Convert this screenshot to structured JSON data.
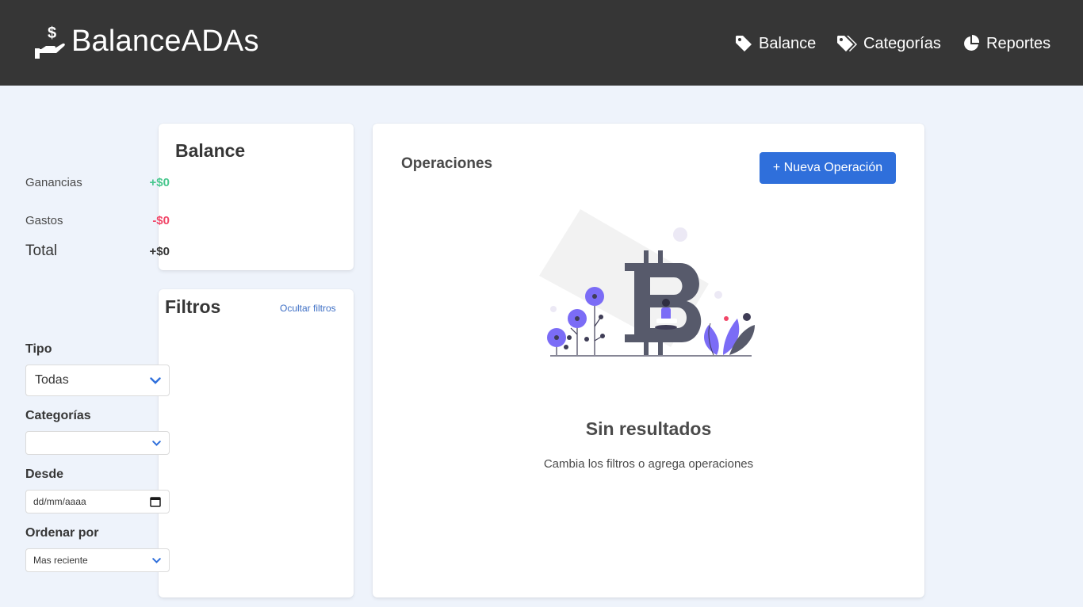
{
  "brand": {
    "name": "BalanceADAs",
    "icon": "hand-holding-dollar-icon"
  },
  "nav": {
    "balance": {
      "label": "Balance",
      "icon": "tag-icon"
    },
    "categorias": {
      "label": "Categorías",
      "icon": "tags-icon"
    },
    "reportes": {
      "label": "Reportes",
      "icon": "pie-chart-icon"
    }
  },
  "balance": {
    "title": "Balance",
    "ganancias": {
      "label": "Ganancias",
      "value": "+$0"
    },
    "gastos": {
      "label": "Gastos",
      "value": "-$0"
    },
    "total": {
      "label": "Total",
      "value": "+$0"
    }
  },
  "filtros": {
    "title": "Filtros",
    "toggle_label": "Ocultar filtros",
    "tipo": {
      "label": "Tipo",
      "value": "Todas"
    },
    "categorias": {
      "label": "Categorías",
      "value": ""
    },
    "desde": {
      "label": "Desde",
      "placeholder": "dd/mm/aaaa"
    },
    "ordenar": {
      "label": "Ordenar por",
      "value": "Mas reciente"
    }
  },
  "operaciones": {
    "title": "Operaciones",
    "new_button": "+ Nueva Operación",
    "empty_title": "Sin resultados",
    "empty_subtitle": "Cambia los filtros o agrega operaciones",
    "illustration": "bitcoin-empty-state-illustration"
  },
  "colors": {
    "navbar": "#363636",
    "background": "#eef3fb",
    "primary": "#2f6fdb",
    "success": "#48c78e",
    "danger": "#f14668",
    "accent": "#7b6cf6"
  }
}
